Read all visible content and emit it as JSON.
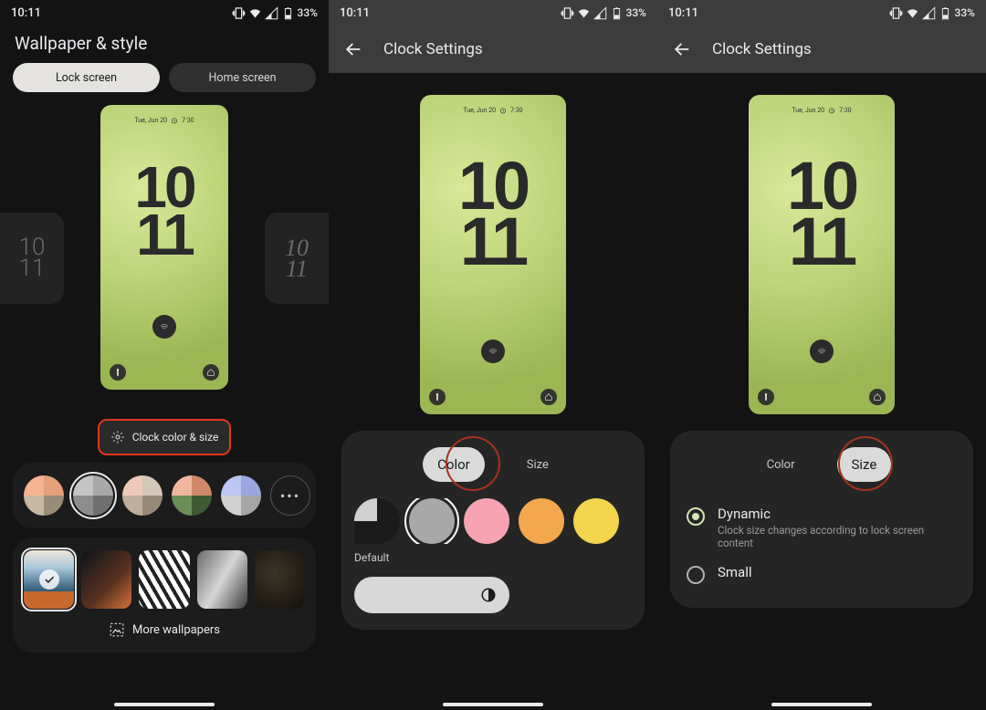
{
  "status": {
    "time": "10:11",
    "battery": "33%"
  },
  "screen1": {
    "title": "Wallpaper & style",
    "tabs": {
      "lock": "Lock screen",
      "home": "Home screen"
    },
    "side_clock": {
      "top": "10",
      "bottom": "11"
    },
    "preview": {
      "date": "Tue, Jun 20",
      "alarm": "7:30",
      "clock_top": "10",
      "clock_bottom": "11"
    },
    "clock_button": "Clock color & size",
    "more_colors": "•••",
    "more_wallpapers": "More wallpapers"
  },
  "screen2": {
    "header": "Clock Settings",
    "preview": {
      "date": "Tue, Jun 20",
      "alarm": "7:30",
      "clock_top": "10",
      "clock_bottom": "11"
    },
    "seg": {
      "color": "Color",
      "size": "Size"
    },
    "default_label": "Default",
    "colors": [
      "#a8a8a8",
      "#f7a3b1",
      "#f3a84d"
    ]
  },
  "screen3": {
    "header": "Clock Settings",
    "preview": {
      "date": "Tue, Jun 20",
      "alarm": "7:30",
      "clock_top": "10",
      "clock_bottom": "11"
    },
    "seg": {
      "color": "Color",
      "size": "Size"
    },
    "options": {
      "dynamic": {
        "label": "Dynamic",
        "sub": "Clock size changes according to lock screen content"
      },
      "small": {
        "label": "Small"
      }
    }
  },
  "palettes": [
    [
      "#f4b393",
      "#e6a07c",
      "#c7b89f",
      "#9a8d78"
    ],
    [
      "#c5c5c5",
      "#a9a9a9",
      "#8d8d8d",
      "#707070"
    ],
    [
      "#efc9b7",
      "#d3c7b6",
      "#bfae9b",
      "#988a78"
    ],
    [
      "#f0b79e",
      "#d0876a",
      "#6a8e58",
      "#3e5a33"
    ],
    [
      "#bcc6f2",
      "#9aa7e0",
      "#d0d0d0",
      "#a5a5a5"
    ]
  ]
}
